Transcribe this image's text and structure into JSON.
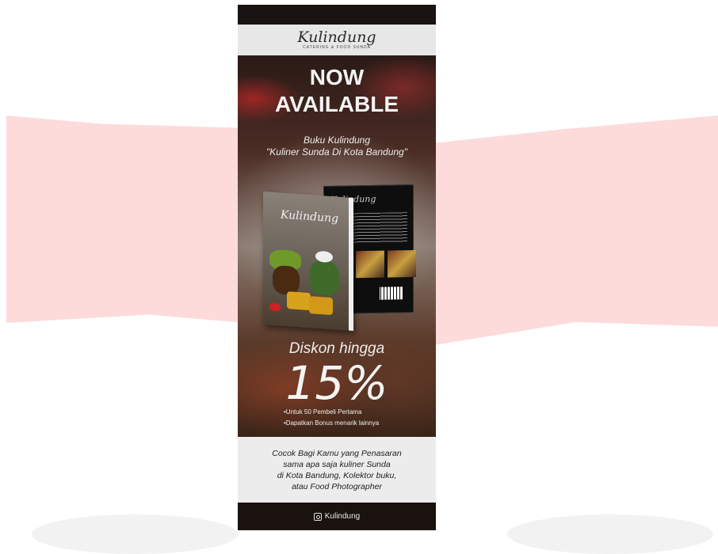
{
  "colors": {
    "pink_bg": "#fddbdb",
    "banner_dark": "#1c1512",
    "panel_light": "#e7e7e7"
  },
  "logo": {
    "name": "Kulindung",
    "tagline": "CATERING & FOOD SUNDA"
  },
  "hero": {
    "line1": "NOW",
    "line2": "AVAILABLE",
    "subtitle_line1": "Buku Kulindung",
    "subtitle_line2": "\"Kuliner Sunda Di Kota Bandung\""
  },
  "book": {
    "front_title": "Kulindung",
    "back_title": "Kulindung"
  },
  "promo": {
    "label": "Diskon hingga",
    "value": "15%",
    "note1": "•Untuk 50 Pembeli Pertama",
    "note2": "•Dapatkan Bonus menarik lainnya"
  },
  "description": {
    "line1": "Cocok Bagi Kamu yang Penasaran",
    "line2": "sama apa saja kuliner Sunda",
    "line3": "di Kota Bandung, Kolektor buku,",
    "line4": "atau Food Photographer"
  },
  "footer": {
    "icon": "instagram-icon",
    "handle": "Kulindung"
  }
}
